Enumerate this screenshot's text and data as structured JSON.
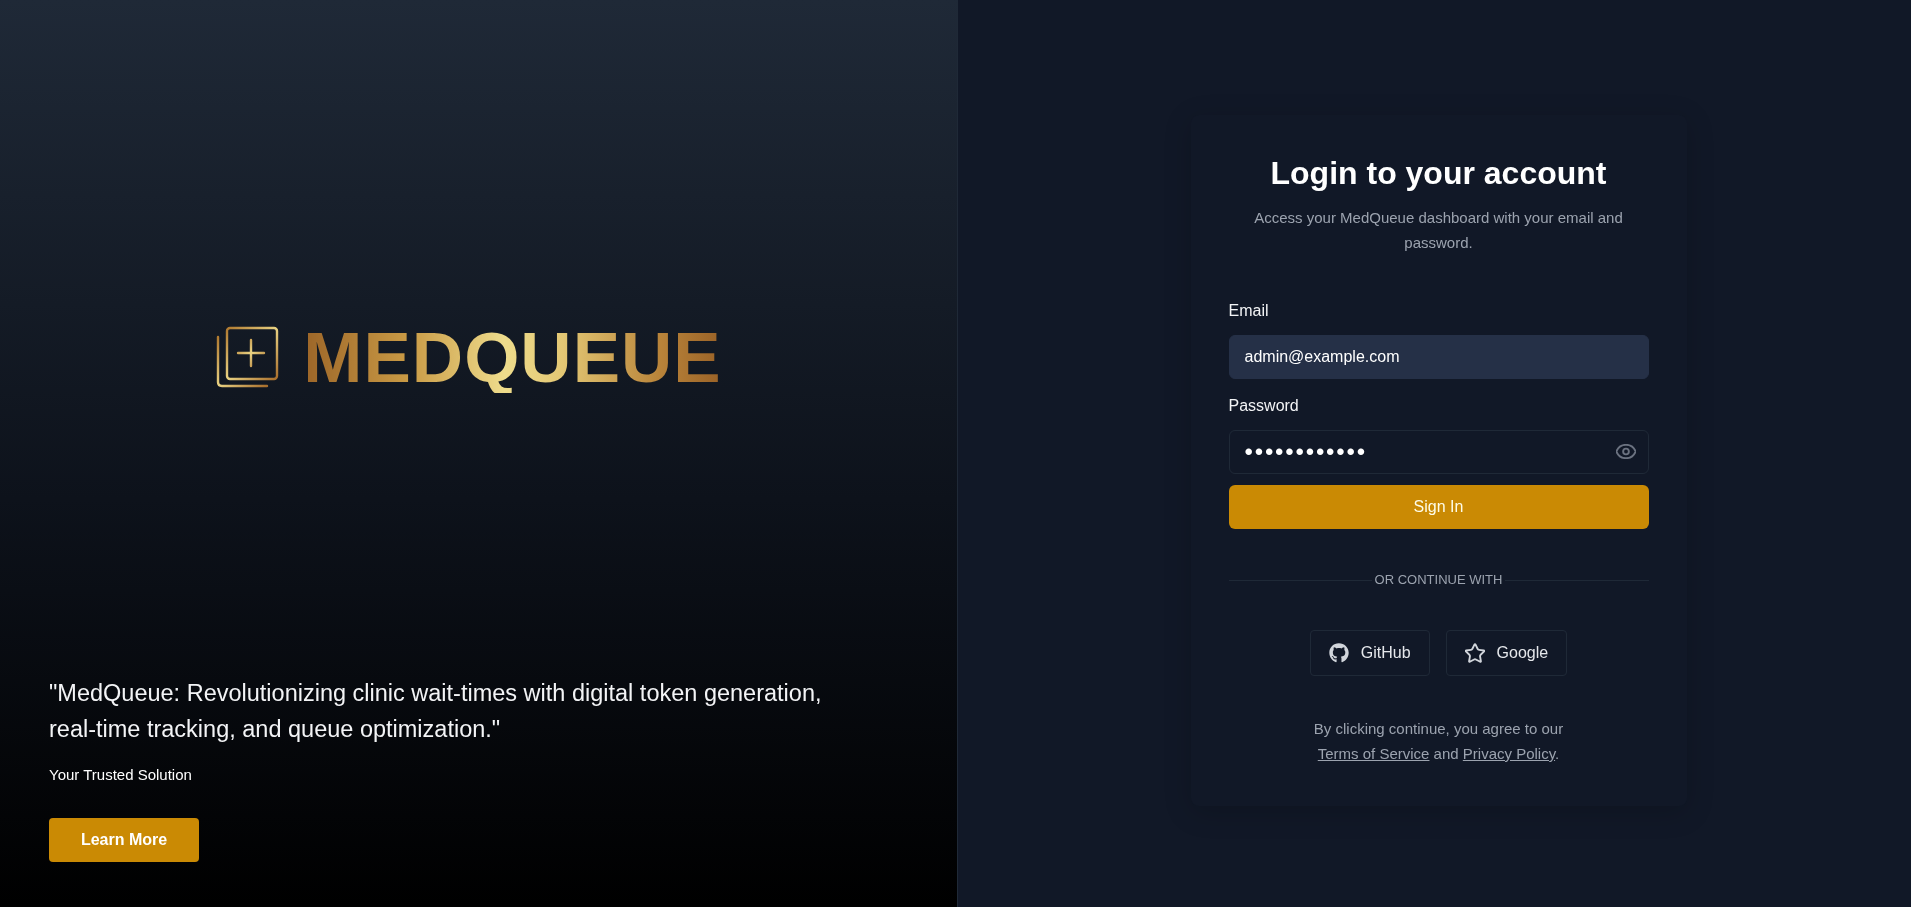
{
  "brand": {
    "logo_text": "MEDQUEUE",
    "quote": "\"MedQueue: Revolutionizing clinic wait-times with digital token generation, real-time tracking, and queue optimization.\"",
    "tagline": "Your Trusted Solution",
    "button": "Learn More"
  },
  "login": {
    "title": "Login to your account",
    "subtitle": "Access your MedQueue dashboard with your email and password.",
    "fields": [
      {
        "kind": "email",
        "label": "Email",
        "value": "admin@example.com",
        "autofilled": true
      },
      {
        "kind": "password",
        "label": "Password",
        "value": "••••••••••••",
        "autofilled": false
      }
    ],
    "submit": "Sign In",
    "divider": "OR CONTINUE WITH",
    "providers": [
      {
        "kind": "github",
        "label": "GitHub"
      },
      {
        "kind": "star",
        "label": "Google"
      }
    ],
    "terms": [
      {
        "kind": "text",
        "text": "By clicking continue, you agree to our "
      },
      {
        "kind": "link",
        "text": "Terms of Service"
      },
      {
        "kind": "text",
        "text": " and "
      },
      {
        "kind": "link",
        "text": "Privacy Policy"
      },
      {
        "kind": "text",
        "text": "."
      }
    ]
  }
}
